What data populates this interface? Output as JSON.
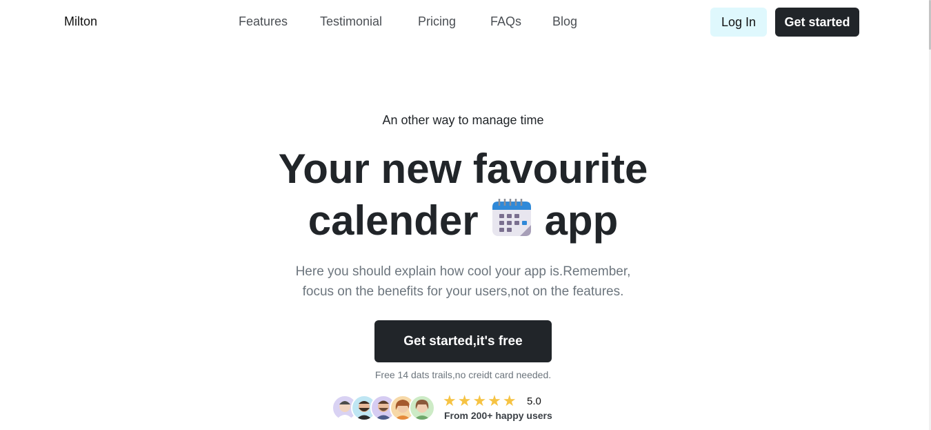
{
  "brand": "Milton",
  "nav": {
    "items": [
      "Features",
      "Testimonial",
      "Pricing",
      "FAQs",
      "Blog"
    ],
    "login_label": "Log In",
    "get_started_label": "Get started"
  },
  "hero": {
    "eyebrow": "An other way to manage time",
    "headline_line1": "Your new favourite",
    "headline_word_before_icon": "calender",
    "headline_word_after_icon": "app",
    "headline_icon": "calendar-icon",
    "description_line1": "Here you should explain how cool your app is.Remember,",
    "description_line2": "focus on the benefits for your users,not on the features.",
    "cta_label": "Get started,it's free",
    "note": "Free 14 dats trails,no creidt card needed."
  },
  "social_proof": {
    "avatars": [
      "avatar-1",
      "avatar-2",
      "avatar-3",
      "avatar-4",
      "avatar-5"
    ],
    "stars": "★★★★★",
    "rating": "5.0",
    "happy_users": "From 200+ happy users"
  },
  "colors": {
    "primary_dark": "#212529",
    "login_bg": "#dff8fd",
    "star": "#f6c343",
    "muted_text": "#6c757d"
  }
}
